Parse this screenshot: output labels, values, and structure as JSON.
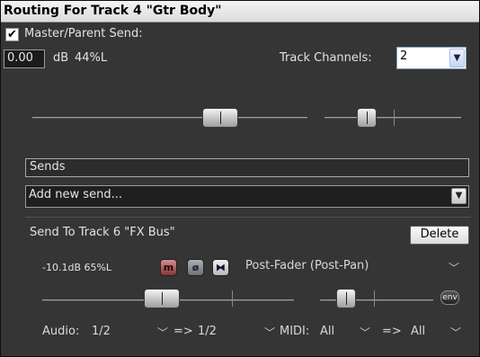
{
  "window": {
    "title": "Routing For Track 4 \"Gtr Body\""
  },
  "master": {
    "send_label": "Master/Parent Send:",
    "send_checked": true,
    "check_glyph": "✔",
    "volume_value": "0.00",
    "volume_unit": "dB",
    "pan_text": "44%L",
    "channels_label": "Track Channels:",
    "channels_value": "2",
    "volume_level": 0.71,
    "pan_level": 0.28
  },
  "sends": {
    "header": "Sends",
    "add_new_placeholder": "Add new send...",
    "send": {
      "title": "Send To Track 6 \"FX Bus\"",
      "delete_label": "Delete",
      "level_text": "-10.1dB 65%L",
      "mute_label": "m",
      "phase_glyph": "ø",
      "mono_glyph": "⧓",
      "mode_value": "Post-Fader (Post-Pan)",
      "env_label": "env",
      "volume_level": 0.47,
      "pan_level": 0.17,
      "audio_label": "Audio:",
      "audio_src": "1/2",
      "arrow1": "=>",
      "audio_dst": "1/2",
      "midi_label": "MIDI:",
      "midi_src": "All",
      "arrow2": "=>",
      "midi_dst": "All"
    }
  },
  "colors": {
    "background": "#353535",
    "titlebar": "#e8e8e8",
    "mute": "#a04040"
  }
}
